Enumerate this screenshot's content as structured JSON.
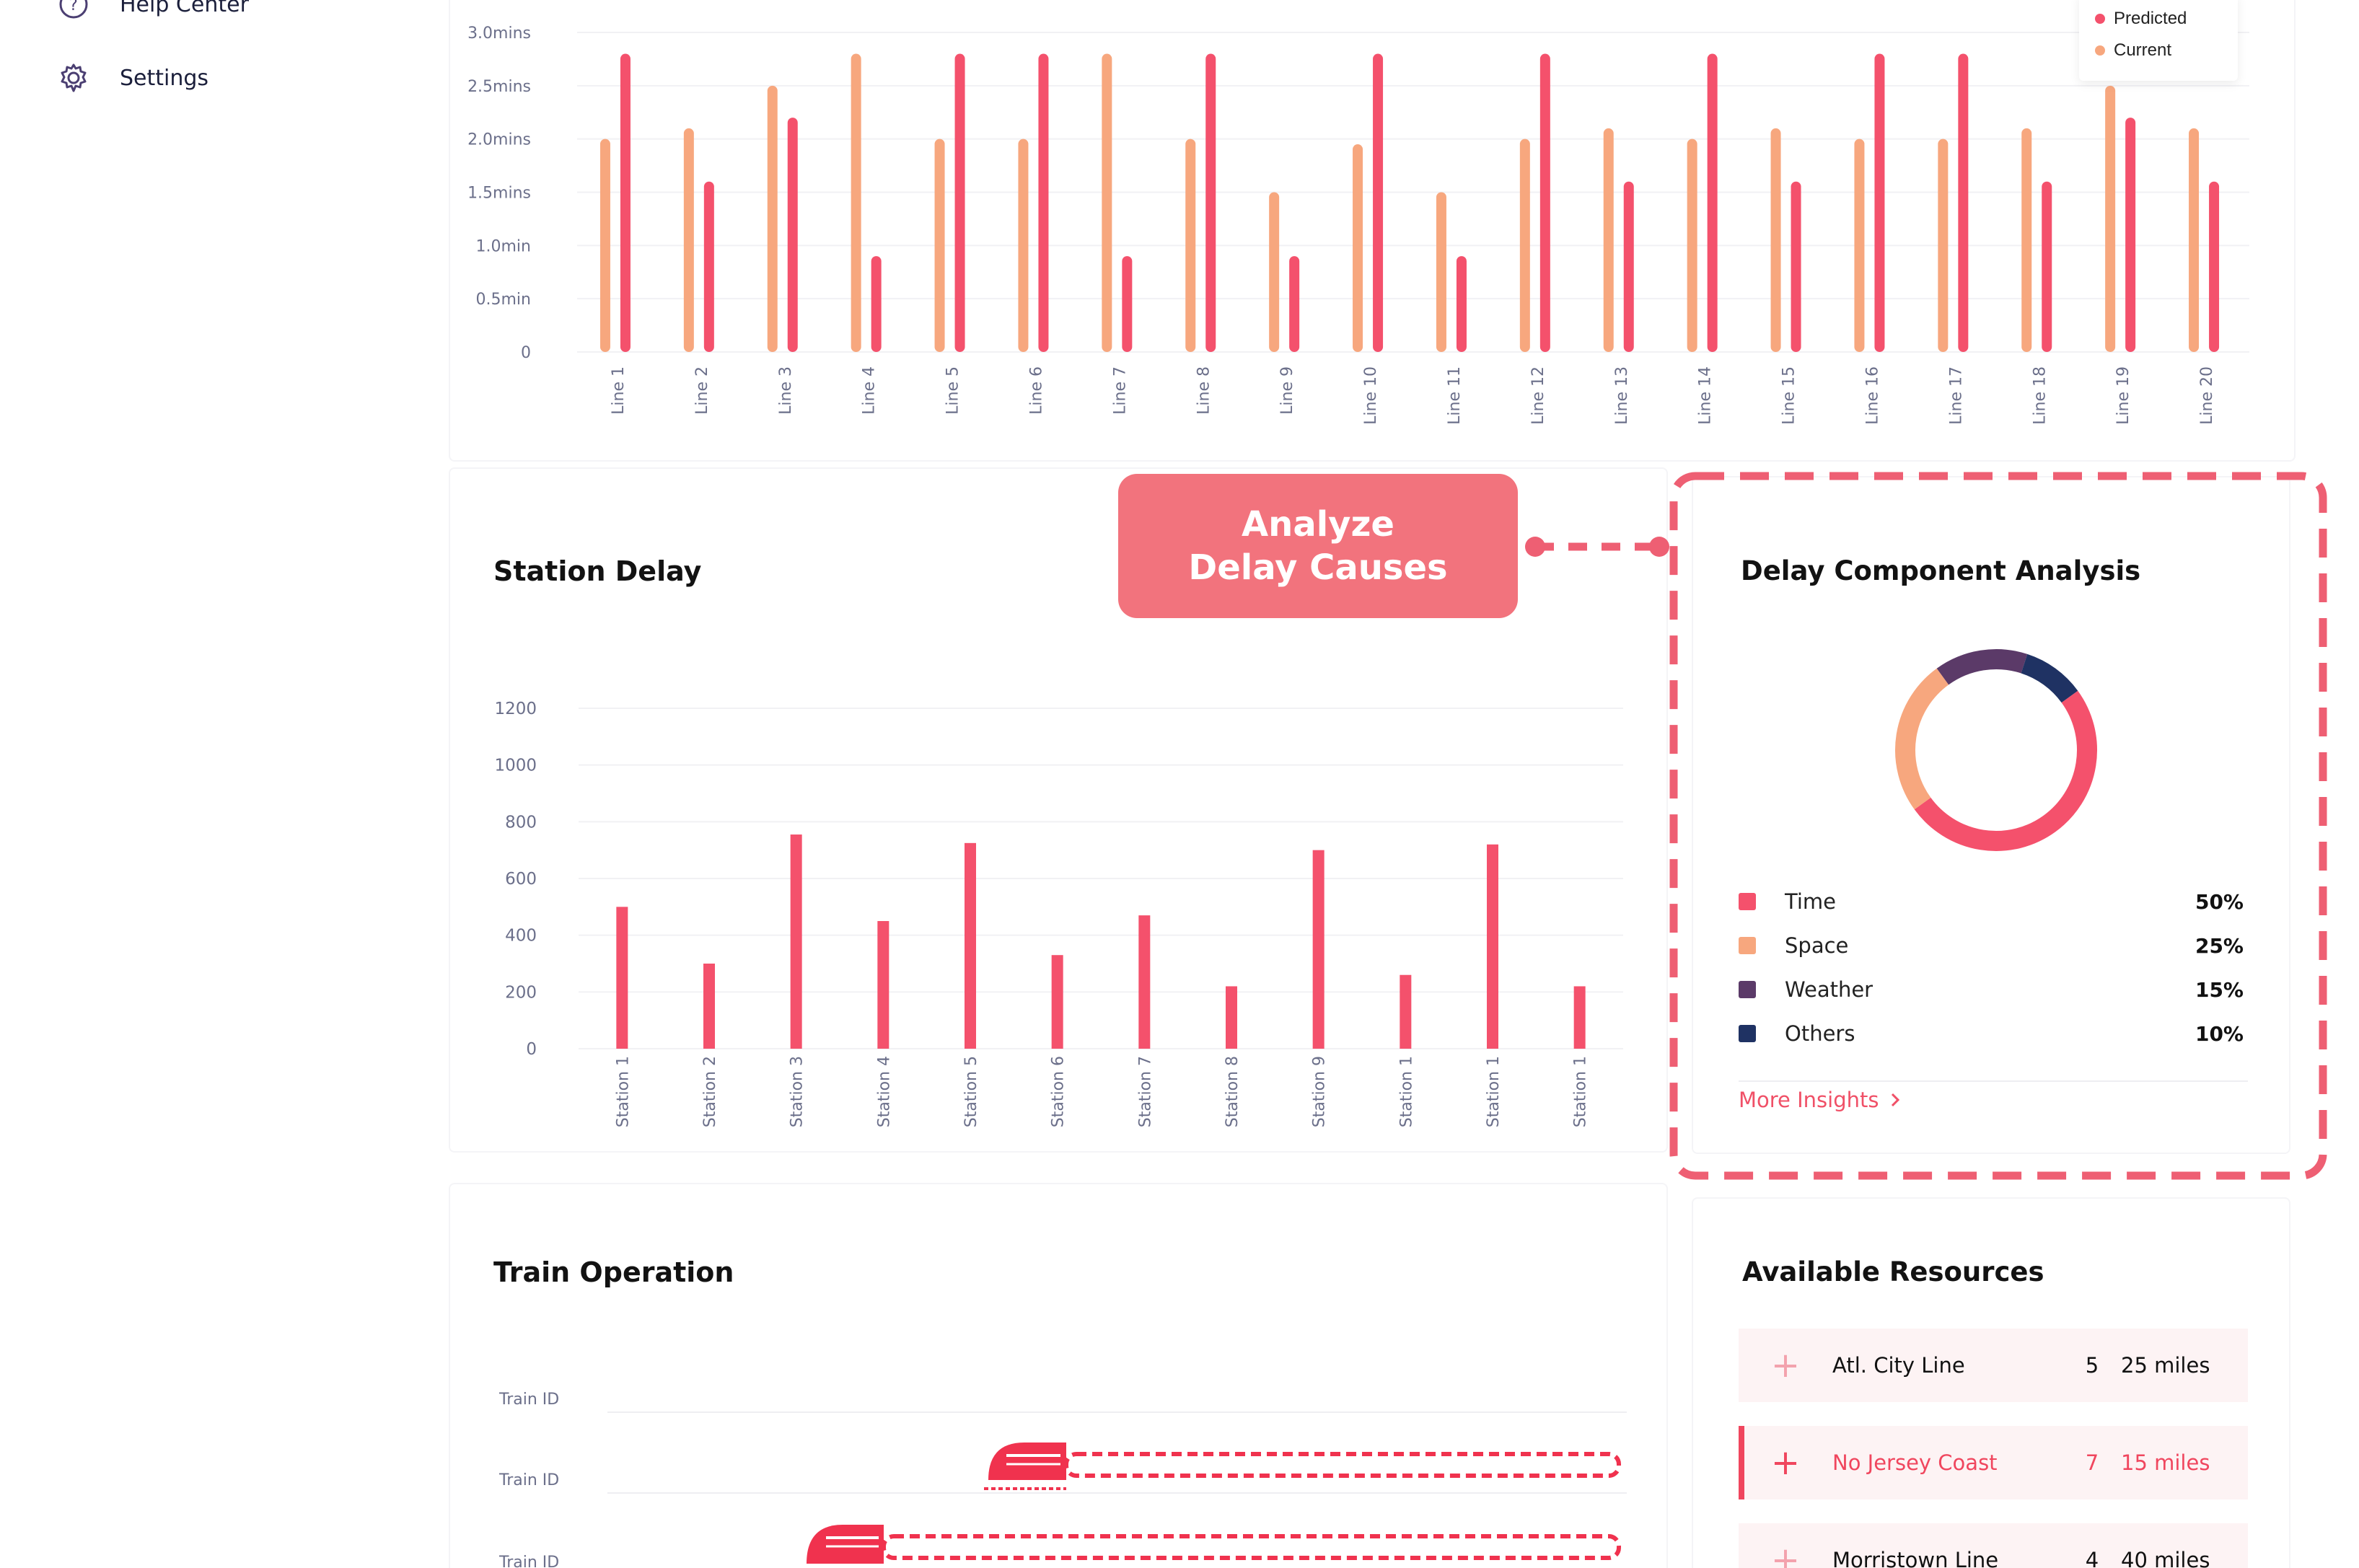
{
  "sidebar": {
    "items": [
      {
        "label": "Help Center",
        "icon": "help-icon"
      },
      {
        "label": "Settings",
        "icon": "gear-icon"
      }
    ]
  },
  "line_chart": {
    "legend": [
      {
        "label": "Predicted",
        "color": "#f4516c"
      },
      {
        "label": "Current",
        "color": "#f7a77e"
      }
    ],
    "y_ticks": [
      "3.0mins",
      "2.5mins",
      "2.0mins",
      "1.5mins",
      "1.0min",
      "0.5min",
      "0"
    ]
  },
  "station_delay": {
    "title": "Station Delay",
    "y_ticks": [
      "1200",
      "1000",
      "800",
      "600",
      "400",
      "200",
      "0"
    ]
  },
  "callout": {
    "text": "Analyze\nDelay Causes"
  },
  "delay_component": {
    "title": "Delay Component Analysis",
    "items": [
      {
        "name": "Time",
        "pct": "50%",
        "color": "#f4516c"
      },
      {
        "name": "Space",
        "pct": "25%",
        "color": "#f7a77e"
      },
      {
        "name": "Weather",
        "pct": "15%",
        "color": "#5b3a68"
      },
      {
        "name": "Others",
        "pct": "10%",
        "color": "#1f3263"
      }
    ],
    "more_link": "More Insights"
  },
  "train_operation": {
    "title": "Train Operation",
    "rows": [
      "Train ID",
      "Train ID",
      "Train ID"
    ]
  },
  "resources": {
    "title": "Available Resources",
    "rows": [
      {
        "name": "Atl. City Line",
        "count": "5",
        "distance": "25 miles",
        "active": false
      },
      {
        "name": "No Jersey Coast",
        "count": "7",
        "distance": "15 miles",
        "active": true
      },
      {
        "name": "Morristown Line",
        "count": "4",
        "distance": "40 miles",
        "active": false
      }
    ]
  },
  "chart_data": [
    {
      "type": "bar",
      "title": "",
      "xlabel": "",
      "ylabel": "",
      "ylim": [
        0,
        3.0
      ],
      "y_unit": "mins",
      "categories": [
        "Line 1",
        "Line 2",
        "Line 3",
        "Line 4",
        "Line 5",
        "Line 6",
        "Line 7",
        "Line 8",
        "Line 9",
        "Line 10",
        "Line 11",
        "Line 12",
        "Line 13",
        "Line 14",
        "Line 15",
        "Line 16",
        "Line 17",
        "Line 18",
        "Line 19",
        "Line 20"
      ],
      "series": [
        {
          "name": "Current",
          "color": "#f7a77e",
          "values": [
            2.0,
            2.1,
            2.5,
            2.8,
            2.0,
            2.0,
            2.8,
            2.0,
            1.5,
            1.95,
            1.5,
            2.0,
            2.1,
            2.0,
            2.1,
            2.0,
            2.0,
            2.1,
            2.5,
            2.1
          ]
        },
        {
          "name": "Predicted",
          "color": "#f4516c",
          "values": [
            2.8,
            1.6,
            2.2,
            0.9,
            2.8,
            2.8,
            0.9,
            2.8,
            0.9,
            2.8,
            0.9,
            2.8,
            1.6,
            2.8,
            1.6,
            2.8,
            2.8,
            1.6,
            2.2,
            1.6
          ]
        }
      ],
      "legend_position": "top-right",
      "grid": true
    },
    {
      "type": "bar",
      "title": "Station Delay",
      "xlabel": "",
      "ylabel": "",
      "ylim": [
        0,
        1200
      ],
      "categories": [
        "Station 1",
        "Station 2",
        "Station 3",
        "Station 4",
        "Station 5",
        "Station 6",
        "Station 7",
        "Station 8",
        "Station 9",
        "Station 1",
        "Station 1",
        "Station 1"
      ],
      "values": [
        500,
        300,
        755,
        450,
        725,
        330,
        470,
        220,
        700,
        260,
        720,
        220
      ],
      "color": "#f4516c",
      "grid": true
    },
    {
      "type": "pie",
      "title": "Delay Component Analysis",
      "labels": [
        "Time",
        "Space",
        "Weather",
        "Others"
      ],
      "values": [
        50,
        25,
        15,
        10
      ],
      "donut": true
    }
  ]
}
